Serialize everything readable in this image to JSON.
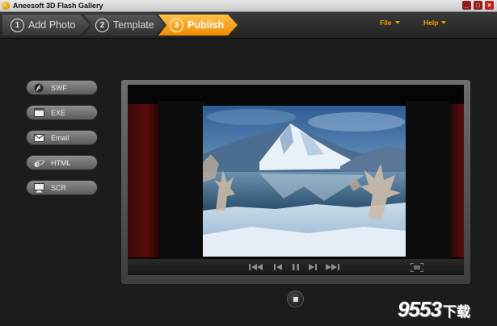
{
  "window": {
    "title": "Aneesoft 3D Flash Gallery",
    "min_glyph": "_",
    "max_glyph": "□",
    "close_glyph": "×"
  },
  "steps": [
    {
      "number": "1",
      "label": "Add Photo",
      "active": false
    },
    {
      "number": "2",
      "label": "Template",
      "active": false
    },
    {
      "number": "3",
      "label": "Publish",
      "active": true
    }
  ],
  "menus": {
    "file": "File",
    "help": "Help"
  },
  "publish_formats": [
    {
      "label": "SWF",
      "icon": "flash-icon"
    },
    {
      "label": "EXE",
      "icon": "window-icon"
    },
    {
      "label": "Email",
      "icon": "envelope-icon"
    },
    {
      "label": "HTML",
      "icon": "browser-e-icon"
    },
    {
      "label": "SCR",
      "icon": "monitor-icon"
    }
  ],
  "player_controls": [
    "first-icon",
    "previous-icon",
    "pause-icon",
    "next-icon",
    "last-icon",
    "fullscreen-icon"
  ],
  "watermark": {
    "text": "9553",
    "cn": "下载"
  },
  "colors": {
    "accent": "#f08a00",
    "menu_text": "#f0a000",
    "background": "#1c1c1c"
  }
}
